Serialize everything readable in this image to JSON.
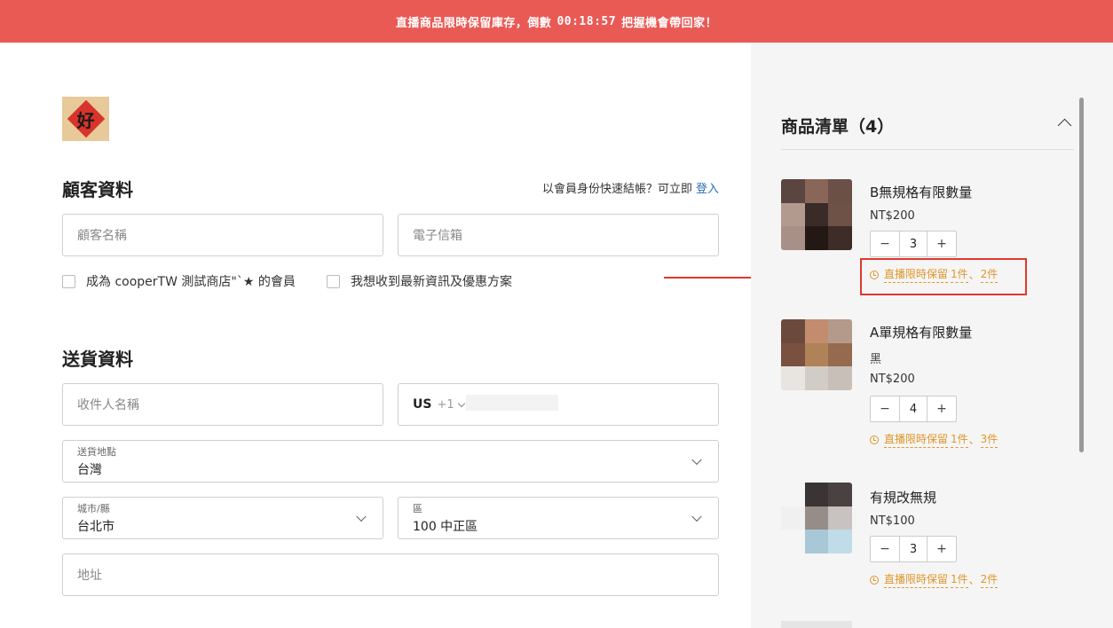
{
  "banner": {
    "prefix": "直播商品限時保留庫存，倒數",
    "timer": "00:18:57",
    "suffix": "把握機會帶回家！"
  },
  "customer": {
    "title": "顧客資料",
    "login_prompt": "以會員身份快速結帳？可立即",
    "login_link": "登入",
    "name_placeholder": "顧客名稱",
    "email_placeholder": "電子信箱",
    "member_checkbox": "成為 cooperTW 測試商店\"`★ 的會員",
    "news_checkbox": "我想收到最新資訊及優惠方案"
  },
  "shipping": {
    "title": "送貨資料",
    "recipient_placeholder": "收件人名稱",
    "phone_country": "US",
    "phone_code": "+1",
    "location_label": "送貨地點",
    "location_value": "台灣",
    "city_label": "城市/縣",
    "city_value": "台北市",
    "district_label": "區",
    "district_value": "100 中正區",
    "address_placeholder": "地址"
  },
  "cart": {
    "title": "商品清單（4）",
    "items": [
      {
        "name": "B無規格有限數量",
        "variant": "",
        "price": "NT$200",
        "qty": "3",
        "hold_prefix": "直播限時保留",
        "hold_a": "1件",
        "hold_sep": "、",
        "hold_b": "2件",
        "thumb_colors": [
          "#5a4540",
          "#8a6658",
          "#6b5048",
          "#b39a8e",
          "#3a2a28",
          "#6e5248",
          "#a89088",
          "#241815",
          "#3e2c28"
        ]
      },
      {
        "name": "A單規格有限數量",
        "variant": "黑",
        "price": "NT$200",
        "qty": "4",
        "hold_prefix": "直播限時保留",
        "hold_a": "1件",
        "hold_sep": "、",
        "hold_b": "3件",
        "thumb_colors": [
          "#6a4a3c",
          "#c48c6e",
          "#b49a8a",
          "#7a5040",
          "#b08258",
          "#966a4e",
          "#e8e4e0",
          "#d2ccc6",
          "#c8c0b8"
        ]
      },
      {
        "name": "有規改無規",
        "variant": "",
        "price": "NT$100",
        "qty": "3",
        "hold_prefix": "直播限時保留",
        "hold_a": "1件",
        "hold_sep": "、",
        "hold_b": "2件",
        "thumb_colors": [
          "#f5f5f5",
          "#3a3434",
          "#4a4242",
          "#f0f0f0",
          "#968c88",
          "#c8c2c0",
          "#f5f5f5",
          "#a8c8d8",
          "#c0dce8"
        ]
      }
    ]
  },
  "colors": {
    "banner_bg": "#e95a55",
    "accent_link": "#2a6fb3",
    "hold_orange": "#e0962a",
    "annotation_red": "#e0392b"
  }
}
